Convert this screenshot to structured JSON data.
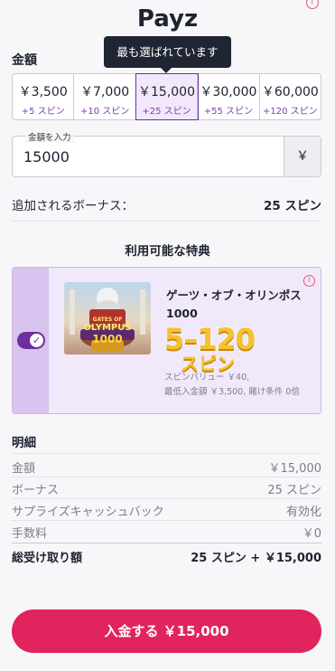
{
  "header": {
    "title": "Payz"
  },
  "amount_section": {
    "label": "金額",
    "tooltip": "最も選ばれています",
    "options": [
      {
        "amount": "￥3,500",
        "spins": "+5 スピン"
      },
      {
        "amount": "￥7,000",
        "spins": "+10 スピン"
      },
      {
        "amount": "￥15,000",
        "spins": "+25 スピン",
        "selected": true
      },
      {
        "amount": "￥30,000",
        "spins": "+55 スピン"
      },
      {
        "amount": "￥60,000",
        "spins": "+120 スピン"
      }
    ]
  },
  "input": {
    "label": "金額を入力",
    "value": "15000",
    "currency": "￥"
  },
  "bonus": {
    "label": "追加されるボーナス：",
    "value": "25 スピン"
  },
  "offers": {
    "title": "利用可能な特典",
    "item": {
      "enabled": true,
      "image_text_top": "GATES OF",
      "image_text_main": "OLYMPUS",
      "image_text_num": "1000",
      "name_line1": "ゲーツ・オブ・オリンポス",
      "name_line2": "1000",
      "big_range": "5–120",
      "big_unit": "スピン",
      "desc_line1": "スピンバリュー ￥40,",
      "desc_line2": "最低入金額 ￥3,500, 賭け条件 0倍"
    }
  },
  "details": {
    "title": "明細",
    "rows": [
      {
        "label": "金額",
        "value": "￥15,000"
      },
      {
        "label": "ボーナス",
        "value": "25 スピン"
      },
      {
        "label": "サプライズキャッシュバック",
        "value": "有効化"
      },
      {
        "label": "手数料",
        "value": "￥0"
      }
    ],
    "total": {
      "label": "総受け取り額",
      "value": "25 スピン + ￥15,000"
    }
  },
  "deposit_button": {
    "label": "入金する ￥15,000"
  },
  "colors": {
    "accent": "#e0245e",
    "purple": "#6b2f9e",
    "selected_bg": "#f1e9fb",
    "tooltip_bg": "#1f2533"
  }
}
